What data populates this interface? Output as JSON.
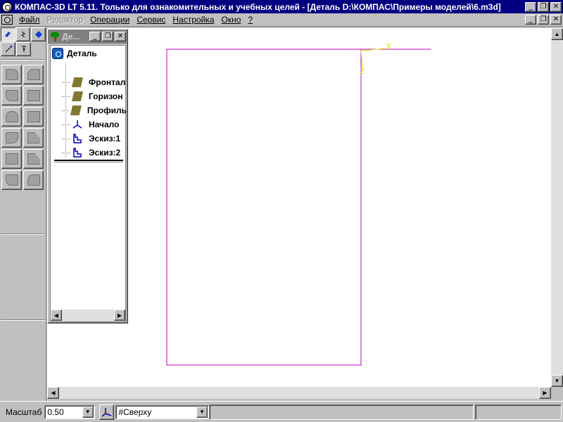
{
  "window": {
    "title": "КОМПАС-3D LT 5.11. Только для ознакомительных и учебных целей - [Деталь D:\\КОМПАС\\Примеры моделей\\6.m3d]",
    "minimize_glyph": "_",
    "restore_glyph": "❐",
    "close_glyph": "✕"
  },
  "menu": {
    "items": [
      {
        "label": "Файл",
        "enabled": true
      },
      {
        "label": "Редактор",
        "enabled": false
      },
      {
        "label": "Операции",
        "enabled": true
      },
      {
        "label": "Сервис",
        "enabled": true
      },
      {
        "label": "Настройка",
        "enabled": true
      },
      {
        "label": "Окно",
        "enabled": true
      },
      {
        "label": "?",
        "enabled": true
      }
    ]
  },
  "tree": {
    "title": "Де...",
    "root": "Деталь",
    "items": [
      {
        "label": "Фронтал",
        "icon": "plane-icon"
      },
      {
        "label": "Горизон",
        "icon": "plane-icon"
      },
      {
        "label": "Профиль",
        "icon": "plane-icon"
      },
      {
        "label": "Начало",
        "icon": "origin-icon"
      },
      {
        "label": "Эскиз:1",
        "icon": "sketch-icon"
      },
      {
        "label": "Эскиз:2",
        "icon": "sketch-icon"
      }
    ]
  },
  "canvas": {
    "axis_x_label": "X",
    "axis_z_label": "Z",
    "sketch_color": "#c000c0",
    "axis_color": "#e0e000"
  },
  "status": {
    "scale_label": "Масштаб",
    "scale_value": "0.50",
    "view_value": "#Сверху"
  },
  "colors": {
    "titlebar": "#000080",
    "face": "#c0c0c0"
  }
}
